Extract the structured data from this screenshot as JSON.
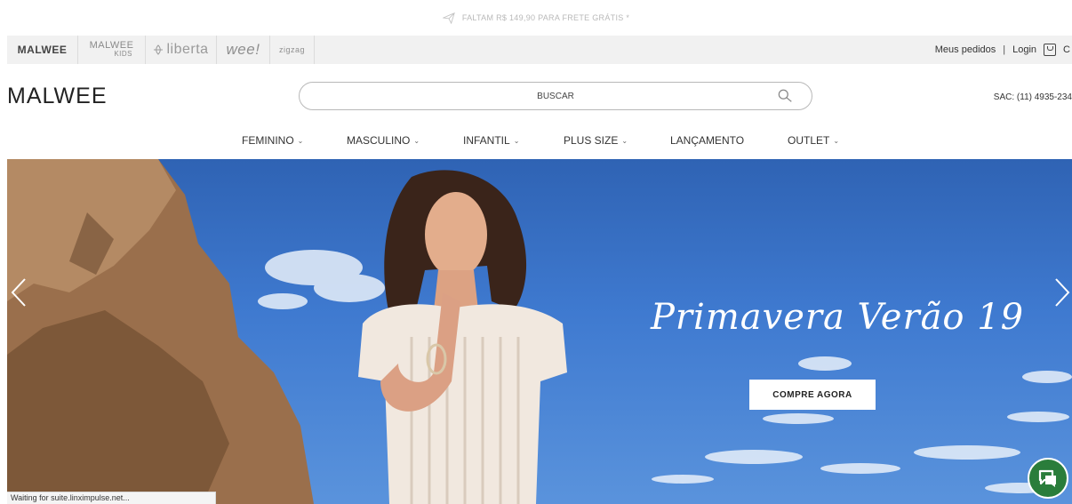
{
  "promo": {
    "text": "FALTAM R$ 149,90 PARA FRETE GRÁTIS *"
  },
  "brands": [
    {
      "label": "MALWEE"
    },
    {
      "label": "MALWEE",
      "sub": "KIDS"
    },
    {
      "label": "liberta"
    },
    {
      "label": "wee!"
    },
    {
      "label": "zigzag"
    }
  ],
  "account": {
    "orders": "Meus pedidos",
    "separator": "|",
    "login": "Login",
    "trail": "C"
  },
  "header": {
    "logo": "MALWEE",
    "search_placeholder": "BUSCAR",
    "sac": "SAC: (11) 4935-234"
  },
  "nav": {
    "items": [
      {
        "label": "FEMININO",
        "has_dropdown": true
      },
      {
        "label": "MASCULINO",
        "has_dropdown": true
      },
      {
        "label": "INFANTIL",
        "has_dropdown": true
      },
      {
        "label": "PLUS SIZE",
        "has_dropdown": true
      },
      {
        "label": "LANÇAMENTO",
        "has_dropdown": false
      },
      {
        "label": "OUTLET",
        "has_dropdown": true
      }
    ],
    "chevron": "⌄"
  },
  "hero": {
    "headline": "Primavera Verão 19",
    "cta": "COMPRE AGORA"
  },
  "status_bar": {
    "text": "Waiting for suite.linximpulse.net..."
  },
  "colors": {
    "sky": "#3f7ad0",
    "chat": "#2a7d3b",
    "text": "#333333"
  },
  "icons": [
    "plane-icon",
    "search-icon",
    "bag-icon",
    "chevron-left-icon",
    "chevron-right-icon",
    "chat-icon",
    "chevron-down-icon"
  ]
}
